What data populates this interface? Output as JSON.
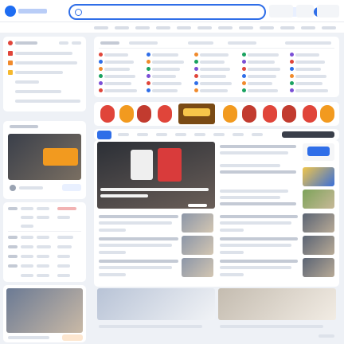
{
  "search": {
    "placeholder": ""
  },
  "colors": {
    "brand": "#2f6ee8",
    "accent": "#e0453a",
    "surface": "#ffffff",
    "canvas": "#eef1f6"
  },
  "icons": [
    "logo-icon",
    "search-icon",
    "camera-icon",
    "flame-icon",
    "avatar-icon"
  ],
  "feed": {
    "selected_tab_index": 0,
    "tab_count": 9
  },
  "note": ""
}
